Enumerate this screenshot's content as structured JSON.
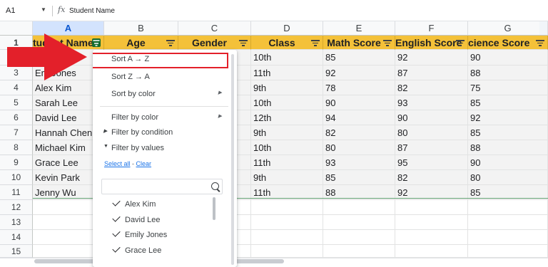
{
  "formula_bar": {
    "cell_ref": "A1",
    "dropdown_icon": "caret-down-icon",
    "fx_label": "fx",
    "value": "Student Name"
  },
  "columns": [
    "A",
    "B",
    "C",
    "D",
    "E",
    "F",
    "G"
  ],
  "selected_column": "A",
  "row_numbers": [
    "1",
    "2",
    "3",
    "4",
    "5",
    "6",
    "7",
    "8",
    "9",
    "10",
    "11",
    "12",
    "13",
    "14",
    "15"
  ],
  "table": {
    "headers": [
      "Student Name",
      "Age",
      "Gender",
      "Class",
      "Math Score",
      "English Score",
      "Science Score"
    ],
    "header_visible": [
      "tudent Name",
      "Age",
      "Gender",
      "Class",
      "Math Score",
      "English Score",
      "cience Score"
    ],
    "rows": [
      [
        "Emily Jones",
        "",
        "",
        "10th",
        "85",
        "92",
        "90"
      ],
      [
        "Emily Jones",
        "",
        "",
        "11th",
        "92",
        "87",
        "88"
      ],
      [
        "Alex Kim",
        "",
        "",
        "9th",
        "78",
        "82",
        "75"
      ],
      [
        "Sarah Lee",
        "",
        "",
        "10th",
        "90",
        "93",
        "85"
      ],
      [
        "David Lee",
        "",
        "",
        "12th",
        "94",
        "90",
        "92"
      ],
      [
        "Hannah Chen",
        "",
        "",
        "9th",
        "82",
        "80",
        "85"
      ],
      [
        "Michael Kim",
        "",
        "",
        "10th",
        "80",
        "87",
        "88"
      ],
      [
        "Grace Lee",
        "",
        "",
        "11th",
        "93",
        "95",
        "90"
      ],
      [
        "Kevin Park",
        "",
        "",
        "9th",
        "85",
        "82",
        "80"
      ],
      [
        "Jenny Wu",
        "",
        "",
        "11th",
        "88",
        "92",
        "85"
      ]
    ],
    "visible_col_a": [
      "",
      "Em  Jones",
      "Alex Kim",
      "Sarah Lee",
      "David Lee",
      "Hannah Chen",
      "Michael Kim",
      "Grace Lee",
      "Kevin Park",
      "Jenny Wu"
    ]
  },
  "filter_menu": {
    "sort_az": "Sort A → Z",
    "sort_za": "Sort Z → A",
    "sort_by_color": "Sort by color",
    "filter_by_color": "Filter by color",
    "filter_by_condition": "Filter by condition",
    "filter_by_values": "Filter by values",
    "select_all": "Select all",
    "separator": " - ",
    "clear": "Clear",
    "search_icon": "search-icon",
    "values": [
      {
        "label": "Alex Kim",
        "checked": true
      },
      {
        "label": "David Lee",
        "checked": true
      },
      {
        "label": "Emily Jones",
        "checked": true
      },
      {
        "label": "Grace Lee",
        "checked": true
      }
    ]
  },
  "colors": {
    "header_fill": "#f4c139",
    "highlight_box": "#e3202a",
    "arrow": "#e3202a",
    "filter_active": "#146c2e",
    "link": "#1a73e8"
  }
}
